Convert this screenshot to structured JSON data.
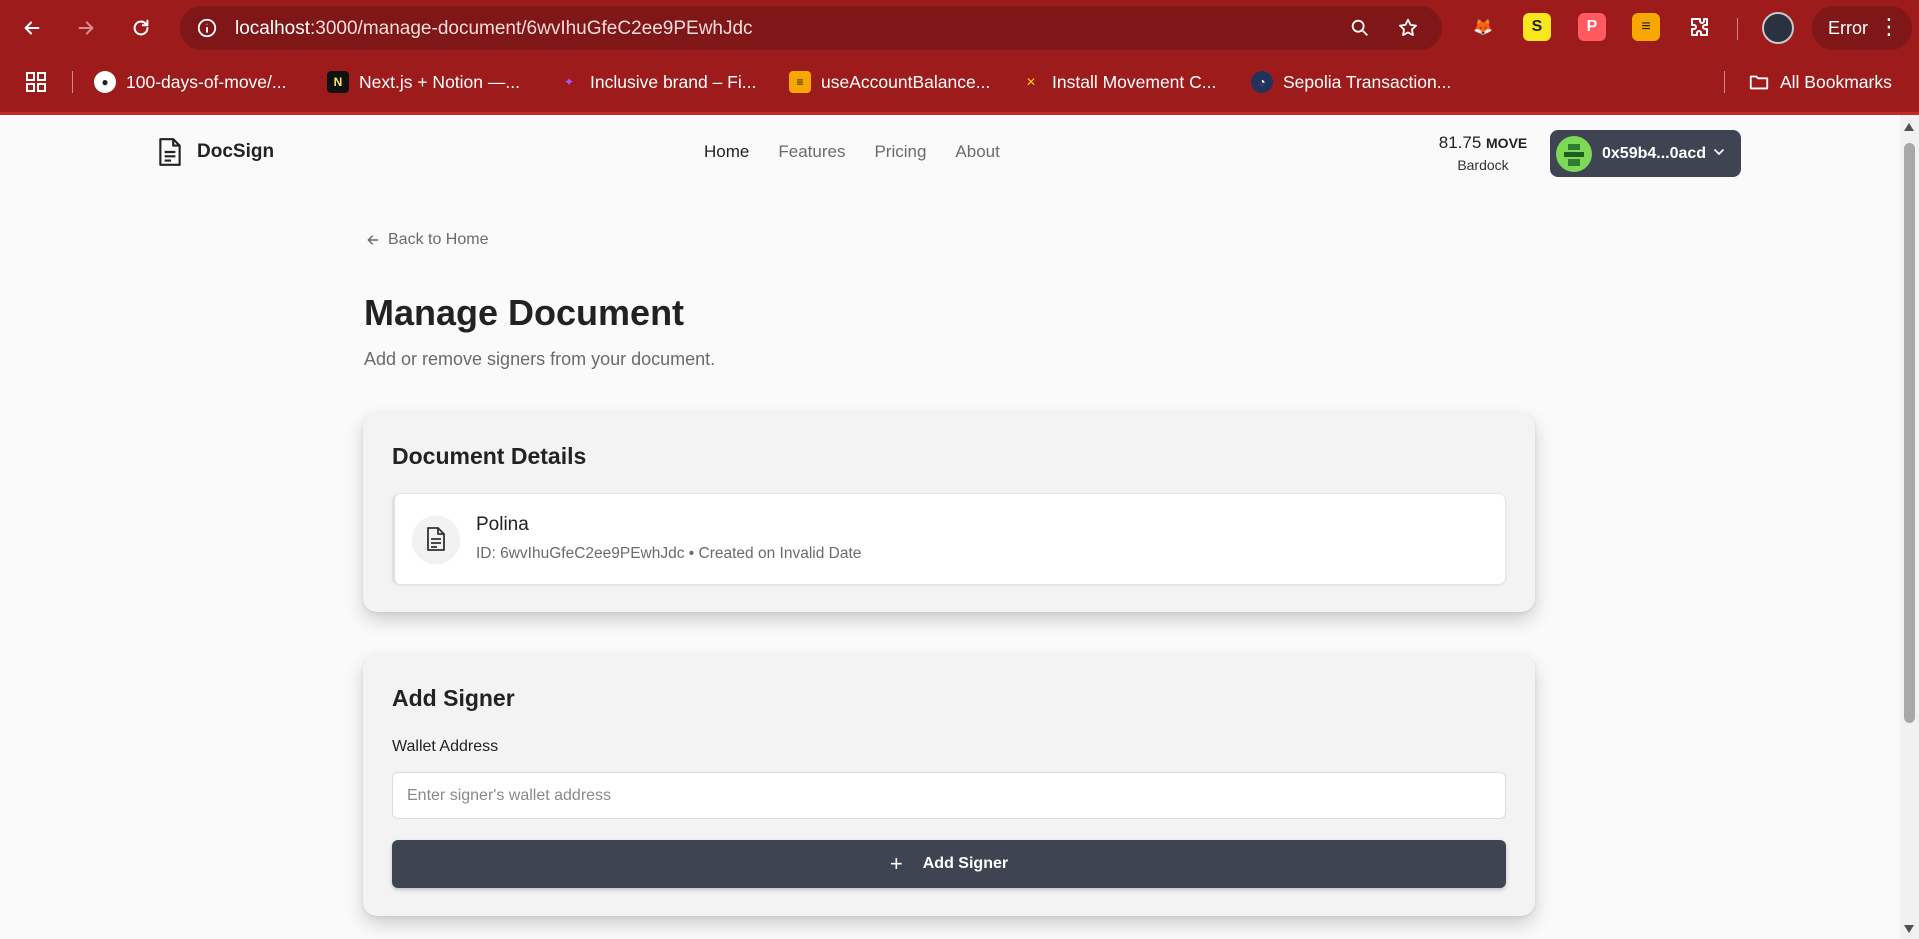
{
  "browser": {
    "url_host": "localhost",
    "url_path": ":3000/manage-document/6wvIhuGfeC2ee9PEwhJdc",
    "error_label": "Error",
    "bookmarks": [
      {
        "label": "100-days-of-move/...",
        "icon": "github-icon"
      },
      {
        "label": "Next.js + Notion —...",
        "icon": "notion-icon"
      },
      {
        "label": "Inclusive brand – Fi...",
        "icon": "figma-icon"
      },
      {
        "label": "useAccountBalance...",
        "icon": "wagmi-icon"
      },
      {
        "label": "Install Movement C...",
        "icon": "movement-icon"
      },
      {
        "label": "Sepolia Transaction...",
        "icon": "etherscan-icon"
      }
    ],
    "all_bookmarks_label": "All Bookmarks"
  },
  "header": {
    "logo_text": "DocSign",
    "nav": [
      "Home",
      "Features",
      "Pricing",
      "About"
    ],
    "balance_amount": "81.75",
    "balance_unit": "MOVE",
    "network": "Bardock",
    "wallet_address": "0x59b4...0acd"
  },
  "main": {
    "back_label": "Back to Home",
    "title": "Manage Document",
    "subtitle": "Add or remove signers from your document.",
    "document_details": {
      "title": "Document Details",
      "name": "Polina",
      "meta": "ID: 6wvIhuGfeC2ee9PEwhJdc • Created on Invalid Date"
    },
    "add_signer": {
      "title": "Add Signer",
      "field_label": "Wallet Address",
      "placeholder": "Enter signer's wallet address",
      "button_label": "Add Signer"
    }
  },
  "colors": {
    "browser_chrome": "#9e1b1b",
    "primary_button": "#3e4452",
    "page_background": "#fafafa"
  }
}
